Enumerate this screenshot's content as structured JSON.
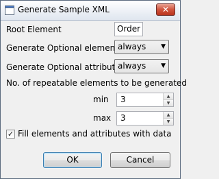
{
  "window": {
    "title": "Generate Sample XML",
    "close_symbol": "✕"
  },
  "form": {
    "root_label": "Root Element",
    "root_value": "Order",
    "optional_elements_label": "Generate Optional elements",
    "optional_elements_value": "always",
    "optional_attributes_label": "Generate Optional attributes",
    "optional_attributes_value": "always",
    "repeatable_label": "No. of repeatable elements to be generated",
    "min_label": "min",
    "min_value": "3",
    "max_label": "max",
    "max_value": "3",
    "fill_label": "Fill elements and attributes with data",
    "fill_checked": true,
    "check_mark": "✓"
  },
  "buttons": {
    "ok": "OK",
    "cancel": "Cancel"
  },
  "icons": {
    "app": "app-window-icon",
    "dropdown": "chevron-down-icon",
    "spin_up": "spin-up-icon",
    "spin_down": "spin-down-icon"
  }
}
